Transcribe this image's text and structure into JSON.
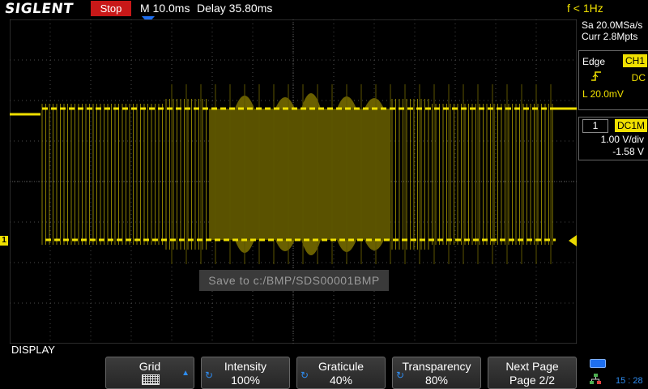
{
  "header": {
    "brand": "SIGLENT",
    "run_state": "Stop",
    "timebase": "M 10.0ms",
    "delay": "Delay 35.80ms",
    "frequency": "f < 1Hz"
  },
  "acquisition": {
    "sample_rate": "Sa 20.0MSa/s",
    "memory": "Curr 2.8Mpts"
  },
  "trigger": {
    "type": "Edge",
    "source": "CH1",
    "slope_icon": "rising-edge-icon",
    "coupling": "DC",
    "level": "L  20.0mV"
  },
  "channel": {
    "number": "1",
    "coupling": "DC1M",
    "scale": "1.00 V/div",
    "offset": "-1.58 V",
    "color": "#f0e000"
  },
  "status": {
    "save_message": "Save to c:/BMP/SDS00001BMP"
  },
  "menu": {
    "title": "DISPLAY",
    "softkeys": [
      {
        "label": "Grid",
        "value": ""
      },
      {
        "label": "Intensity",
        "value": "100%"
      },
      {
        "label": "Graticule",
        "value": "40%"
      },
      {
        "label": "Transparency",
        "value": "80%"
      },
      {
        "label": "Next Page",
        "value": "Page 2/2"
      }
    ]
  },
  "clock": "15 : 28"
}
